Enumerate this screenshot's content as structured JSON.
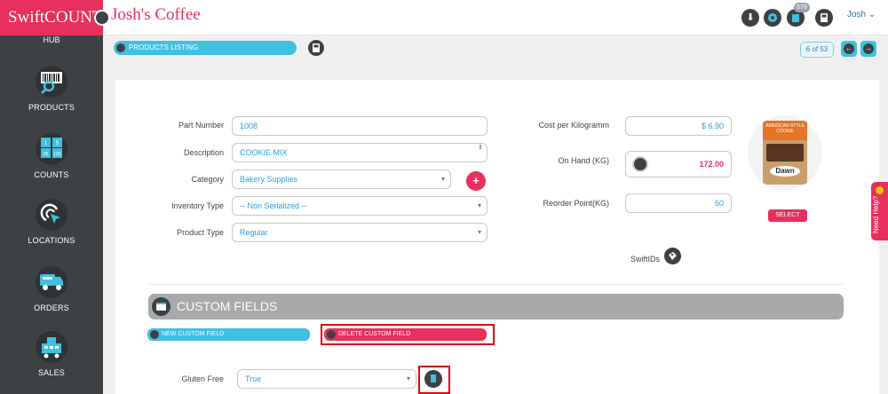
{
  "app": {
    "logo": "SwiftCOUNT",
    "title": "Josh's Coffee",
    "user": "Josh",
    "notification_count": "676"
  },
  "sidebar": {
    "hub_label": "HUB",
    "items": [
      {
        "label": "PRODUCTS",
        "icon": "barcode-search-icon"
      },
      {
        "label": "COUNTS",
        "icon": "count-grid-icon"
      },
      {
        "label": "LOCATIONS",
        "icon": "location-pointer-icon"
      },
      {
        "label": "ORDERS",
        "icon": "delivery-truck-icon"
      },
      {
        "label": "SALES",
        "icon": "sales-cart-icon"
      }
    ]
  },
  "toolbar": {
    "breadcrumb": "PRODUCTS LISTING",
    "pager": "6 of 53"
  },
  "form": {
    "part_number_label": "Part Number",
    "part_number": "1008",
    "description_label": "Description",
    "description": "COOKIE MIX",
    "category_label": "Category",
    "category": "Bakery Supplies",
    "inventory_type_label": "Inventory Type",
    "inventory_type": "-- Non Serialized --",
    "product_type_label": "Product Type",
    "product_type": "Regular",
    "cost_label": "Cost per Kilogramm",
    "cost": "$ 6.90",
    "on_hand_label": "On Hand (KG)",
    "on_hand": "172.00",
    "reorder_label": "Reorder Point(KG)",
    "reorder": "60",
    "select_label": "SELECT",
    "swiftids_label": "SwiftIDs"
  },
  "product_image": {
    "package_text": "AMERICAN STYLE COOKIE",
    "brand": "Dawn"
  },
  "custom_fields": {
    "title": "CUSTOM FIELDS",
    "new_label": "NEW CUSTOM FIELD",
    "delete_label": "DELETE CUSTOM FIELD",
    "gluten_label": "Gluten Free",
    "gluten_value": "True"
  },
  "help": {
    "label": "Need Help?"
  },
  "colors": {
    "brand": "#e8305c",
    "accent": "#3fc0e0",
    "sidebar": "#3e4144"
  }
}
